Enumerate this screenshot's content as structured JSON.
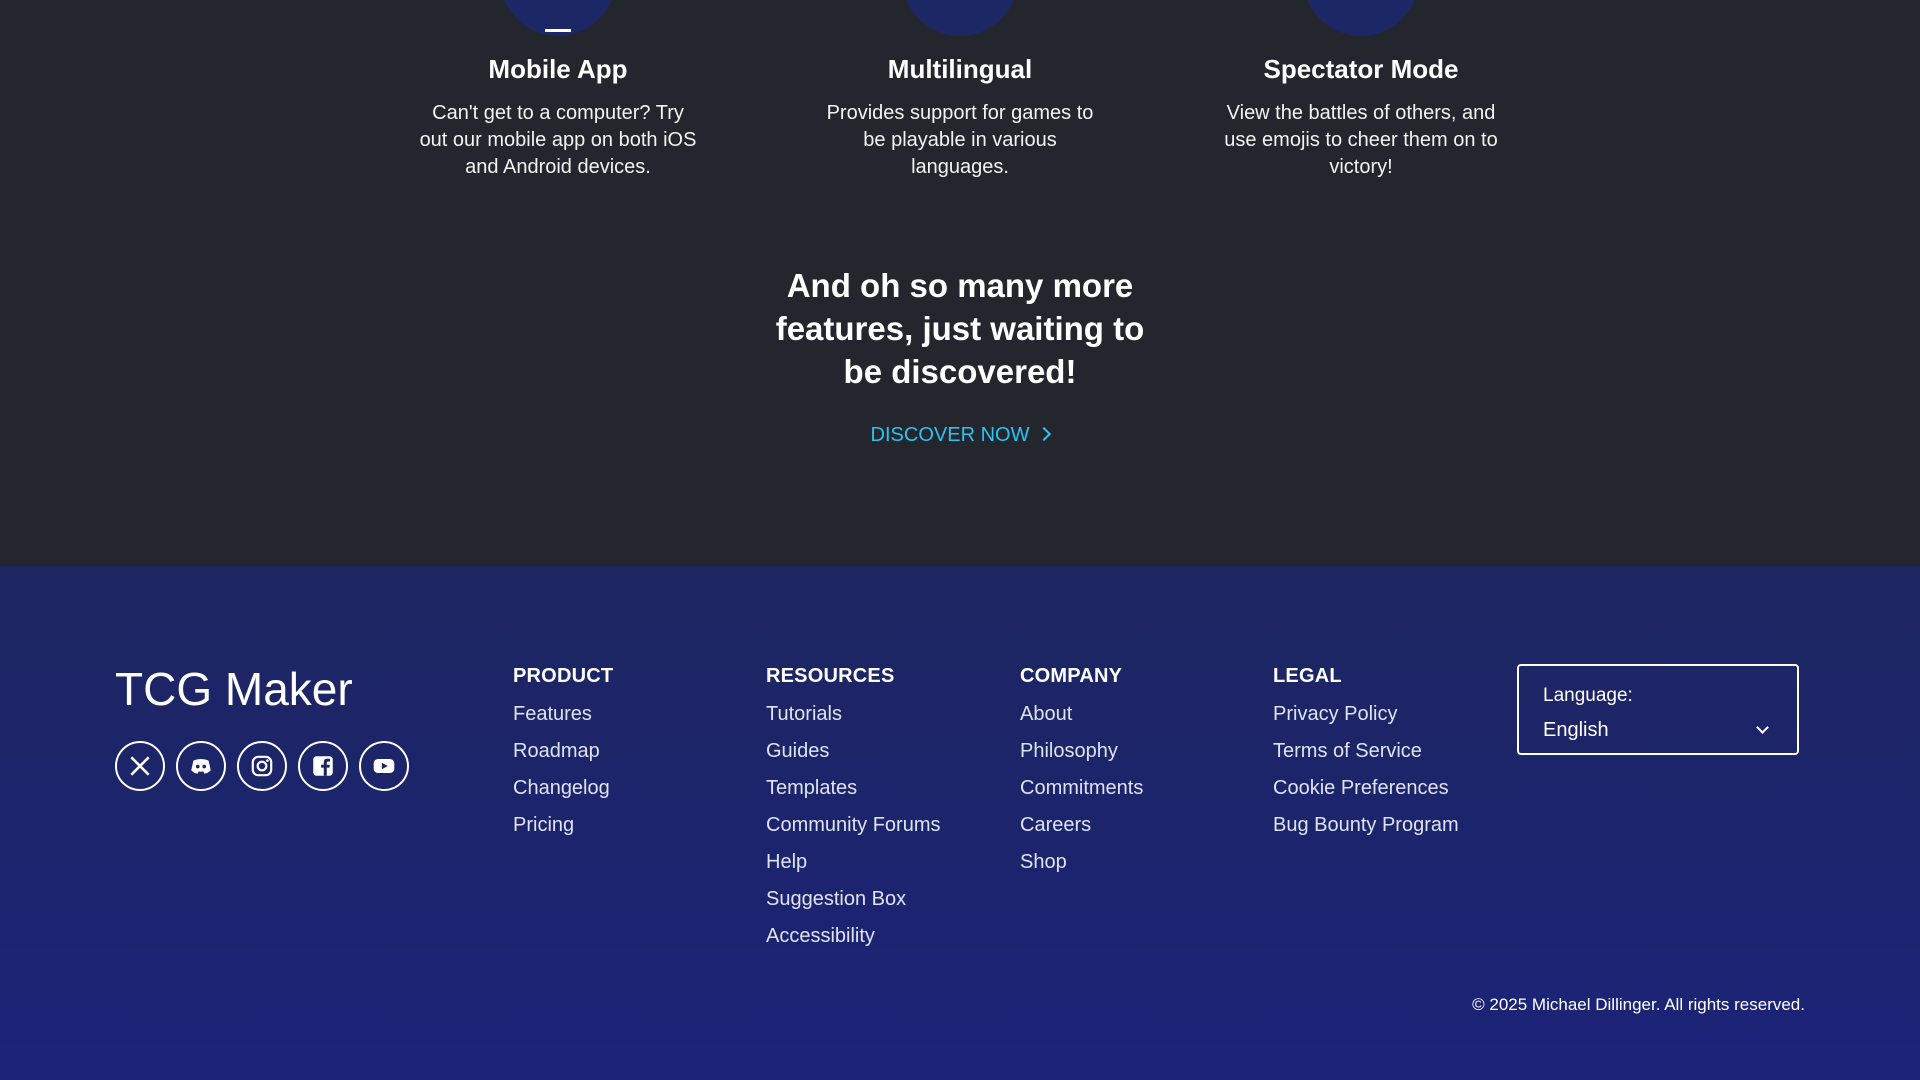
{
  "features": [
    {
      "title": "Mobile App",
      "desc": "Can't get to a computer? Try out our mobile app on both iOS and Android devices."
    },
    {
      "title": "Multilingual",
      "desc": "Provides support for games to be playable in various languages."
    },
    {
      "title": "Spectator Mode",
      "desc": "View the battles of others, and use emojis to cheer them on to victory!"
    }
  ],
  "more": {
    "heading": "And oh so many more features, just waiting to be discovered!",
    "cta": "DISCOVER NOW"
  },
  "footer": {
    "brand": "TCG Maker",
    "socials": [
      "x-icon",
      "discord-icon",
      "instagram-icon",
      "facebook-icon",
      "youtube-icon"
    ],
    "columns": [
      {
        "heading": "PRODUCT",
        "links": [
          "Features",
          "Roadmap",
          "Changelog",
          "Pricing"
        ]
      },
      {
        "heading": "RESOURCES",
        "links": [
          "Tutorials",
          "Guides",
          "Templates",
          "Community Forums",
          "Help",
          "Suggestion Box",
          "Accessibility"
        ]
      },
      {
        "heading": "COMPANY",
        "links": [
          "About",
          "Philosophy",
          "Commitments",
          "Careers",
          "Shop"
        ]
      },
      {
        "heading": "LEGAL",
        "links": [
          "Privacy Policy",
          "Terms of Service",
          "Cookie Preferences",
          "Bug Bounty Program"
        ]
      }
    ],
    "language": {
      "label": "Language:",
      "value": "English"
    },
    "copyright": "© 2025 Michael Dillinger. All rights reserved."
  },
  "colors": {
    "top_bg": "#24262d",
    "footer_bg": "#1d2660",
    "accent": "#2cc2f2",
    "icon_circle": "#1c2766"
  }
}
